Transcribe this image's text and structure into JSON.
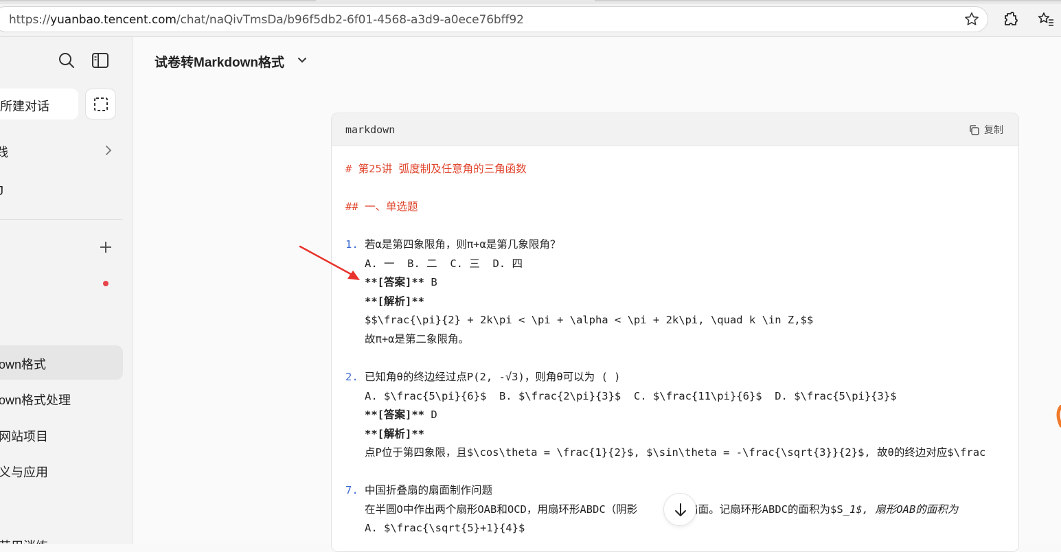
{
  "browser": {
    "url_scheme": "https://",
    "url_host": "yuanbao.tencent.com",
    "url_path": "/chat/naQivTmsDa/b96f5db2-6f01-4568-a3d9-a0ece76bff92",
    "icons": [
      "search-icon",
      "sidebar-toggle-icon",
      "star-icon",
      "extensions-icon",
      "favorites-icon"
    ]
  },
  "sidebar": {
    "new_chat_label": "所建对话",
    "items": [
      {
        "label": "践"
      },
      {
        "label": "J"
      }
    ],
    "history": [
      {
        "label": "own格式"
      },
      {
        "label": "own格式处理"
      },
      {
        "label": "网站项目"
      },
      {
        "label": "义与应用"
      },
      {
        "label": "芸用消练"
      }
    ]
  },
  "chat": {
    "title": "试卷转Markdown格式"
  },
  "code_block": {
    "language": "markdown",
    "copy_label": "复制",
    "lines": {
      "l1": "# 第25讲 弧度制及任意角的三角函数",
      "l2": "## 一、单选题",
      "q1_num": "1.",
      "q1_text": " 若α是第四象限角，则π+α是第几象限角？",
      "q1_opts": "   A. 一  B. 二  C. 三  D. 四",
      "q1_ans_label": "   **[答案]**",
      "q1_ans": " B",
      "q1_exp_label": "   **[解析]**",
      "q1_formula": "   $$\\frac{\\pi}{2} + 2k\\pi < \\pi + \\alpha < \\pi + 2k\\pi, \\quad k \\in Z,$$",
      "q1_concl": "   故π+α是第二象限角。",
      "q2_num": "2.",
      "q2_text": " 已知角θ的终边经过点P(2, -√3)，则角θ可以为 ( )",
      "q2_opts": "   A. $\\frac{5\\pi}{6}$  B. $\\frac{2\\pi}{3}$  C. $\\frac{11\\pi}{6}$  D. $\\frac{5\\pi}{3}$",
      "q2_ans_label": "   **[答案]**",
      "q2_ans": " D",
      "q2_exp_label": "   **[解析]**",
      "q2_exp": "   点P位于第四象限，且$\\cos\\theta = \\frac{1}{2}$, $\\sin\\theta = -\\frac{\\sqrt{3}}{2}$, 故θ的终边对应$\\frac",
      "q7_num": "7.",
      "q7_text": " 中国折叠扇的扇面制作问题",
      "q7_line2a": "   在半圆O中作出两个扇形OAB和OCD，用扇环形ABDC（阴影",
      "q7_line2b": "制作扇面。记扇环形ABDC的面积为$S_",
      "q7_line2c": "1$, 扇形OAB的面积为",
      "q7_opt": "   A. $\\frac{\\sqrt{5}+1}{4}$"
    }
  },
  "colors": {
    "heading": "#e0462d",
    "list_number": "#3b6bd0",
    "arrow": "#e8322b"
  }
}
